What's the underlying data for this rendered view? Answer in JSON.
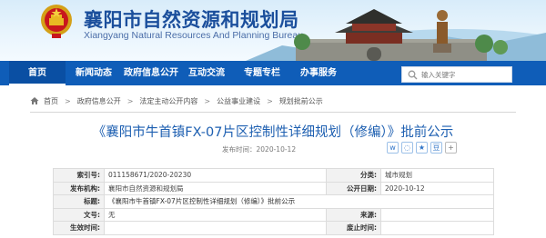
{
  "site": {
    "title": "襄阳市自然资源和规划局",
    "subtitle": "Xiangyang Natural Resources And Planning Bureau"
  },
  "nav": {
    "items": [
      {
        "label": "首页"
      },
      {
        "label": "新闻动态"
      },
      {
        "label": "政府信息公开"
      },
      {
        "label": "互动交流"
      },
      {
        "label": "专题专栏"
      },
      {
        "label": "办事服务"
      }
    ]
  },
  "search": {
    "placeholder": "输入关键字"
  },
  "breadcrumb": [
    "首页",
    "政府信息公开",
    "法定主动公开内容",
    "公益事业建设",
    "规划批前公示"
  ],
  "article": {
    "title": "《襄阳市牛首镇FX-07片区控制性详细规划（修编）》批前公示",
    "date": "发布时间：2020-10-12",
    "share_icons": [
      "weibo-icon",
      "wechat-icon",
      "qzone-icon",
      "douban-icon",
      "share-plus-icon"
    ]
  },
  "meta": {
    "index_label": "索引号:",
    "index_value": "011158671/2020-20230",
    "category_label": "分类:",
    "category_value": "城市规划",
    "publisher_label": "发布机构:",
    "publisher_value": "襄阳市自然资源和规划局",
    "publish_date_label": "公开日期:",
    "publish_date_value": "2020-10-12",
    "title_label": "标题:",
    "title_value": "《襄阳市牛首镇FX-07片区控制性详细规划（修编）》批前公示",
    "doc_no_label": "文号:",
    "doc_no_value": "无",
    "source_label": "来源:",
    "source_value": "",
    "effective_label": "生效时间:",
    "effective_value": "",
    "expire_label": "废止时间:",
    "expire_value": ""
  },
  "colors": {
    "nav_bg": "#0f5db8",
    "title_blue": "#1d5fb1",
    "header_title": "#1b4f9c"
  }
}
